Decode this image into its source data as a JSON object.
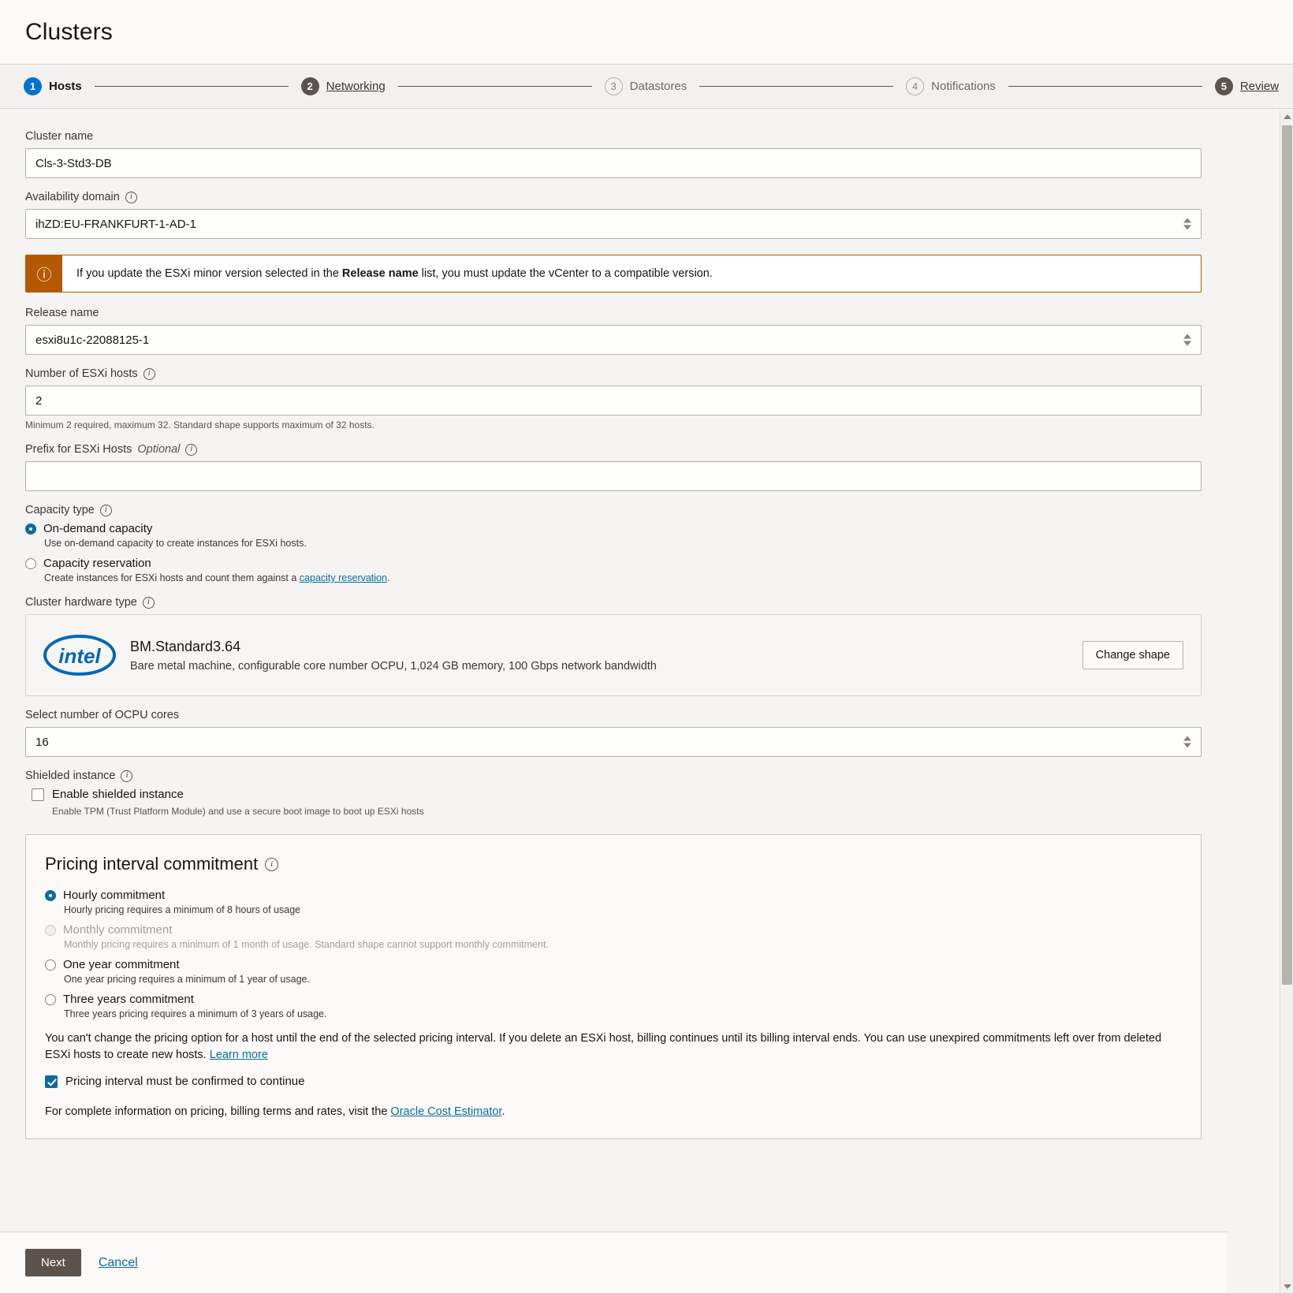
{
  "header": {
    "title": "Clusters"
  },
  "stepper": {
    "steps": [
      {
        "num": "1",
        "label": "Hosts",
        "state": "active"
      },
      {
        "num": "2",
        "label": "Networking",
        "state": "done"
      },
      {
        "num": "3",
        "label": "Datastores",
        "state": "todo"
      },
      {
        "num": "4",
        "label": "Notifications",
        "state": "todo"
      },
      {
        "num": "5",
        "label": "Review",
        "state": "done"
      }
    ]
  },
  "form": {
    "cluster_name": {
      "label": "Cluster name",
      "value": "Cls-3-Std3-DB",
      "placeholder": ""
    },
    "availability_domain": {
      "label": "Availability domain",
      "value": "ihZD:EU-FRANKFURT-1-AD-1"
    },
    "banner": {
      "text_before": "If you update the ESXi minor version selected in the ",
      "bold": "Release name",
      "text_after": " list, you must update the vCenter to a compatible version."
    },
    "release_name": {
      "label": "Release name",
      "value": "esxi8u1c-22088125-1"
    },
    "host_count": {
      "label": "Number of ESXi hosts",
      "value": "2",
      "helper": "Minimum 2 required, maximum 32. Standard shape supports maximum of 32 hosts."
    },
    "prefix": {
      "label": "Prefix for ESXi Hosts",
      "optional": "Optional",
      "value": "",
      "placeholder": ""
    },
    "capacity_type": {
      "label": "Capacity type",
      "options": [
        {
          "label": "On-demand capacity",
          "desc": "Use on-demand capacity to create instances for ESXi hosts.",
          "selected": true
        },
        {
          "label": "Capacity reservation",
          "desc_before": "Create instances for ESXi hosts and count them against a ",
          "desc_link": "capacity reservation",
          "desc_after": ".",
          "selected": false
        }
      ]
    },
    "hardware_type": {
      "label": "Cluster hardware type",
      "vendor": "intel",
      "shape_name": "BM.Standard3.64",
      "shape_desc": "Bare metal machine, configurable core number OCPU, 1,024 GB memory, 100 Gbps network bandwidth",
      "change_button": "Change shape"
    },
    "ocpu": {
      "label": "Select number of OCPU cores",
      "value": "16"
    },
    "shielded": {
      "label": "Shielded instance",
      "checkbox_label": "Enable shielded instance",
      "checked": false,
      "desc": "Enable TPM (Trust Platform Module) and use a secure boot image to boot up ESXi hosts"
    }
  },
  "pricing": {
    "title": "Pricing interval commitment",
    "options": [
      {
        "label": "Hourly commitment",
        "desc": "Hourly pricing requires a minimum of 8 hours of usage",
        "selected": true,
        "disabled": false
      },
      {
        "label": "Monthly commitment",
        "desc": "Monthly pricing requires a minimum of 1 month of usage. Standard shape cannot support monthly commitment.",
        "selected": false,
        "disabled": true
      },
      {
        "label": "One year commitment",
        "desc": "One year pricing requires a minimum of 1 year of usage.",
        "selected": false,
        "disabled": false
      },
      {
        "label": "Three years commitment",
        "desc": "Three years pricing requires a minimum of 3 years of usage.",
        "selected": false,
        "disabled": false
      }
    ],
    "note_text": "You can't change the pricing option for a host until the end of the selected pricing interval. If you delete an ESXi host, billing continues until its billing interval ends. You can use unexpired commitments left over from deleted ESXi hosts to create new hosts. ",
    "note_link": "Learn more",
    "confirm_label": "Pricing interval must be confirmed to continue",
    "confirm_checked": true,
    "footer_before": "For complete information on pricing, billing terms and rates, visit the ",
    "footer_link": "Oracle Cost Estimator",
    "footer_after": "."
  },
  "footer": {
    "next_label": "Next",
    "cancel_label": "Cancel"
  },
  "colors": {
    "accent": "#0a6c9e",
    "step_active": "#0572ce",
    "step_done": "#5b534c",
    "warning": "#b35900",
    "link": "#0a6c9e"
  }
}
